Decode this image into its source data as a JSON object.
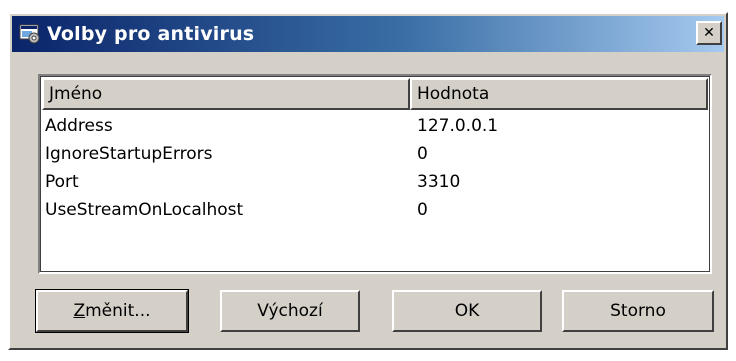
{
  "window": {
    "title": "Volby pro antivirus",
    "close_glyph": "✕"
  },
  "list": {
    "columns": [
      {
        "label": "Jméno"
      },
      {
        "label": "Hodnota"
      }
    ],
    "rows": [
      {
        "name": "Address",
        "value": "127.0.0.1"
      },
      {
        "name": "IgnoreStartupErrors",
        "value": "0"
      },
      {
        "name": "Port",
        "value": "3310"
      },
      {
        "name": "UseStreamOnLocalhost",
        "value": "0"
      }
    ]
  },
  "buttons": {
    "change_accel": "Z",
    "change_rest": "měnit...",
    "defaults": "Výchozí",
    "ok": "OK",
    "cancel": "Storno"
  },
  "icons": {
    "app": "settings-window-icon",
    "close": "close-icon"
  }
}
